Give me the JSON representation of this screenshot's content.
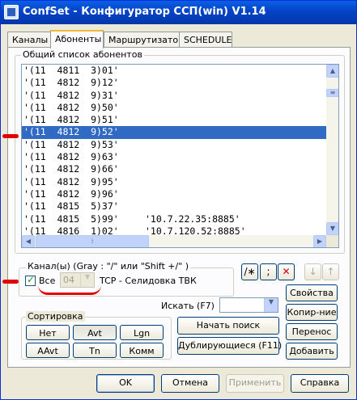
{
  "window": {
    "title": "ConfSet - Конфигуратор  ССП(win)  V1.14"
  },
  "tabs": [
    "Каналы",
    "Абоненты",
    "Маршрутизатор",
    "SCHEDULE"
  ],
  "active_tab": "Абоненты",
  "subscribers": {
    "group_label": "Общий список абонентов",
    "rows": [
      {
        "text": "'(11  4811  3)01'",
        "extra": ""
      },
      {
        "text": "'(11  4812  9)12'",
        "extra": ""
      },
      {
        "text": "'(11  4812  9)31'",
        "extra": ""
      },
      {
        "text": "'(11  4812  9)50'",
        "extra": ""
      },
      {
        "text": "'(11  4812  9)51'",
        "extra": ""
      },
      {
        "text": "'(11  4812  9)52'",
        "extra": ""
      },
      {
        "text": "'(11  4812  9)53'",
        "extra": ""
      },
      {
        "text": "'(11  4812  9)63'",
        "extra": ""
      },
      {
        "text": "'(11  4812  9)66'",
        "extra": ""
      },
      {
        "text": "'(11  4812  9)95'",
        "extra": ""
      },
      {
        "text": "'(11  4812  9)96'",
        "extra": ""
      },
      {
        "text": "'(11  4815  5)37'",
        "extra": ""
      },
      {
        "text": "'(11  4815  5)99'",
        "extra": "'10.7.22.35:8885'"
      },
      {
        "text": "'(11  4816  1)02'",
        "extra": "'10.7.120.52:8885'"
      }
    ],
    "selected_index": 5
  },
  "channels": {
    "label": "Канал(ы)  (Gray : \"/\" или  \"Shift +/\" )",
    "all_label": "Все",
    "all_checked": true,
    "channel_value": "04",
    "channel_desc": "TCP - Селидовка ТВК"
  },
  "toolbar": {
    "btn1": "/∗",
    "btn2": ";",
    "btn3": "✓",
    "btn4": "✕",
    "btn5": "↓",
    "btn6": "↑"
  },
  "search": {
    "label": "Искать (F7)",
    "value": "",
    "start_button": "Начать поиск",
    "duplicates_button": "Дублирующиеся (F11)"
  },
  "sort": {
    "label": "Сортировка",
    "buttons": [
      "Нет",
      "Avt",
      "Lgn",
      "AAvt",
      "Tn",
      "Комм"
    ]
  },
  "side_buttons": {
    "properties": "Свойства",
    "copy": "Копир-ние",
    "move": "Перенос",
    "add": "Добавить"
  },
  "dialog_buttons": {
    "ok": "OK",
    "cancel": "Отмена",
    "apply": "Применить",
    "help": "Справка"
  },
  "colors": {
    "selection": "#316ac5",
    "annotation": "#e00000",
    "titlebar": "#0a5fe6"
  }
}
